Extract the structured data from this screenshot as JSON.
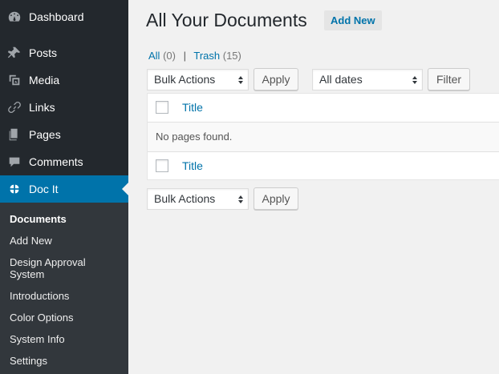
{
  "sidebar": {
    "items": [
      {
        "label": "Dashboard",
        "icon": "dashboard-icon"
      },
      {
        "label": "Posts",
        "icon": "pin-icon"
      },
      {
        "label": "Media",
        "icon": "media-icon"
      },
      {
        "label": "Links",
        "icon": "link-icon"
      },
      {
        "label": "Pages",
        "icon": "pages-icon"
      },
      {
        "label": "Comments",
        "icon": "comments-icon"
      },
      {
        "label": "Doc It",
        "icon": "docit-icon",
        "current": true
      }
    ],
    "submenu": [
      {
        "label": "Documents",
        "active": true
      },
      {
        "label": "Add New"
      },
      {
        "label": "Design Approval System"
      },
      {
        "label": "Introductions"
      },
      {
        "label": "Color Options"
      },
      {
        "label": "System Info"
      },
      {
        "label": "Settings"
      }
    ]
  },
  "page": {
    "title": "All Your Documents",
    "add_new": "Add New"
  },
  "views": {
    "all_label": "All",
    "all_count": "(0)",
    "separator": "|",
    "trash_label": "Trash",
    "trash_count": "(15)"
  },
  "top_nav": {
    "bulk_actions": "Bulk Actions",
    "apply": "Apply",
    "dates": "All dates",
    "filter": "Filter"
  },
  "table": {
    "title_header": "Title",
    "empty_message": "No pages found.",
    "title_footer": "Title"
  },
  "bottom_nav": {
    "bulk_actions": "Bulk Actions",
    "apply": "Apply"
  },
  "colors": {
    "sidebar_bg": "#23282d",
    "submenu_bg": "#32373c",
    "accent": "#0073aa",
    "page_bg": "#f1f1f1"
  }
}
